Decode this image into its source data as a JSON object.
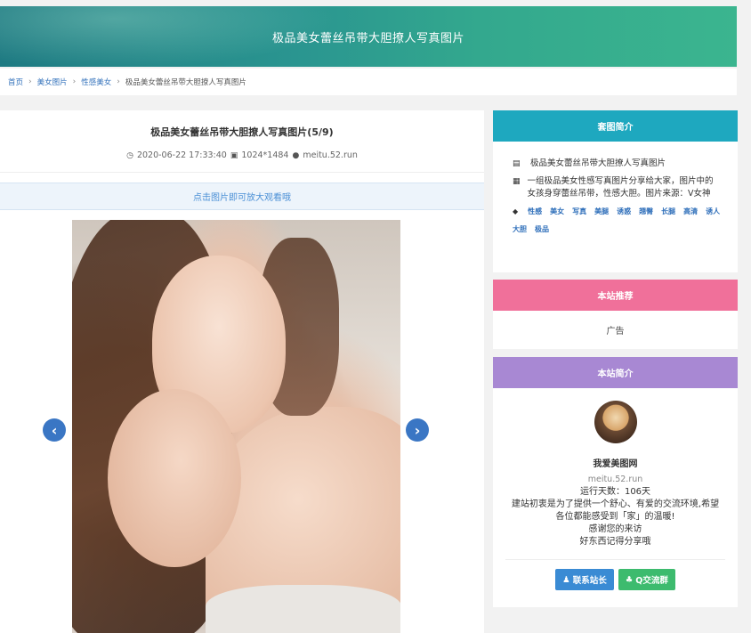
{
  "banner": {
    "title": "极品美女蕾丝吊带大胆撩人写真图片"
  },
  "breadcrumb": {
    "home": "首页",
    "cat1": "美女图片",
    "cat2": "性感美女",
    "current": "极品美女蕾丝吊带大胆撩人写真图片",
    "sep": "›"
  },
  "article": {
    "title": "极品美女蕾丝吊带大胆撩人写真图片(5/9)",
    "date": "2020-06-22 17:33:40",
    "resolution": "1024*1484",
    "author": "meitu.52.run",
    "tip": "点击图片即可放大观看哦"
  },
  "gallery_info": {
    "header": "套图简介",
    "name": "极品美女蕾丝吊带大胆撩人写真图片",
    "desc": "一组极品美女性感写真图片分享给大家，图片中的女孩身穿蕾丝吊带，性感大胆。图片来源：V女神",
    "tags": [
      "性感",
      "美女",
      "写真",
      "美腿",
      "诱惑",
      "翘臀",
      "长腿",
      "高清",
      "诱人",
      "大胆",
      "极品"
    ]
  },
  "recommend": {
    "header": "本站推荐",
    "content": "广告"
  },
  "about": {
    "header": "本站简介",
    "site_name": "我爱美图网",
    "domain": "meitu.52.run",
    "days": "运行天数：106天",
    "line1": "建站初衷是为了提供一个舒心、有爱的交流环境,希望",
    "line2": "各位都能感受到「家」的温暖!",
    "line3": "感谢您的来访",
    "line4": "好东西记得分享哦",
    "btn_contact": "联系站长",
    "btn_group": "Q交流群"
  },
  "colors": {
    "info_header": "#1ea8bf",
    "recommend_header": "#f0709a",
    "about_header": "#a888d3",
    "link": "#2f6fba"
  }
}
